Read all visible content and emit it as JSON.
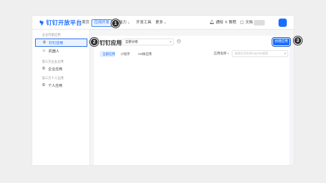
{
  "brand": {
    "logo_text": "钉钉开放平台",
    "brand_color": "#1a6eff"
  },
  "topnav": {
    "items": [
      {
        "label": "首页"
      },
      {
        "label": "应用开发"
      },
      {
        "label": "能力"
      },
      {
        "label": "开发工具"
      },
      {
        "label": "更多"
      }
    ],
    "right": [
      {
        "label": "通知",
        "icon": "bell-icon"
      },
      {
        "label": "教程",
        "icon": "location-icon"
      },
      {
        "label": "文档",
        "icon": "document-icon"
      }
    ]
  },
  "sidebar": {
    "groups": [
      {
        "title": "企业内部应用",
        "items": [
          {
            "label": "钉钉应用",
            "icon": "app-icon"
          },
          {
            "label": "机器人",
            "icon": "robot-icon"
          }
        ]
      },
      {
        "title": "第三方企业应用",
        "items": [
          {
            "label": "企业应用",
            "icon": "app-icon"
          }
        ]
      },
      {
        "title": "第三方个人应用",
        "items": [
          {
            "label": "个人应用",
            "icon": "app-icon"
          }
        ]
      }
    ]
  },
  "main": {
    "title": "钉钉应用",
    "filter_value": "全部分组",
    "create_button": "创建应用",
    "tabs": [
      {
        "label": "全部应用"
      },
      {
        "label": "小程序"
      },
      {
        "label": "H5微应用"
      }
    ],
    "search_label": "应用名称",
    "search_placeholder": "请按应用名称/AgentId搜索"
  },
  "callouts": [
    "1",
    "2",
    "3"
  ]
}
